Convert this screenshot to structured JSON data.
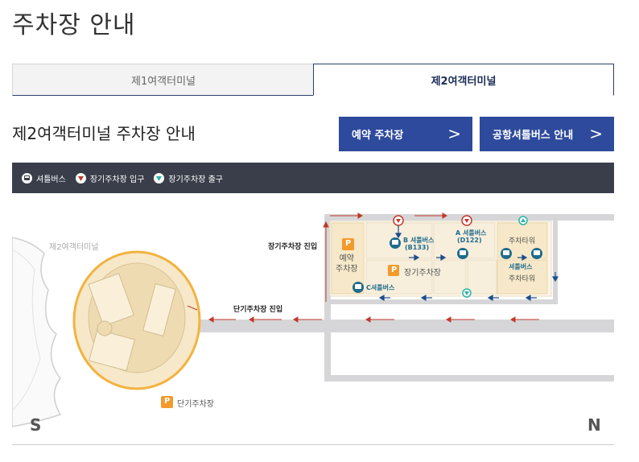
{
  "page": {
    "title": "주차장 안내"
  },
  "tabs": [
    {
      "label": "제1여객터미널",
      "active": false
    },
    {
      "label": "제2여객터미널",
      "active": true
    }
  ],
  "section": {
    "title": "제2여객터미널 주차장 안내"
  },
  "buttons": {
    "reserve_parking": "예약 주차장",
    "shuttle_info": "공항셔틀버스 안내",
    "chevron": ">"
  },
  "legend": [
    {
      "icon": "shuttle-bus-icon",
      "label": "셔틀버스",
      "color": "#1a5a8a"
    },
    {
      "icon": "entrance-icon",
      "label": "장기주차장 입구",
      "color": "#c0392b"
    },
    {
      "icon": "exit-icon",
      "label": "장기주차장 출구",
      "color": "#2bb5a8"
    }
  ],
  "map": {
    "terminal_label": "제2여객터미널",
    "long_term_entry": "장기주차장 진입",
    "short_term_entry": "단기주차장 진입",
    "reserved_parking": "예약\n주차장",
    "long_term_parking": "장기주차장",
    "short_term_parking": "단기주차장",
    "parking_tower_1": "주차타워",
    "parking_tower_2": "주차타워",
    "shuttle_b": "B 셔틀버스",
    "shuttle_b_code": "(B133)",
    "shuttle_a": "A 셔틀버스",
    "shuttle_a_code": "(D122)",
    "shuttle_c": "C셔틀버스",
    "shuttle_tower": "셔틀버스",
    "parking_symbol": "P",
    "south": "S",
    "north": "N",
    "colors": {
      "road": "#d6d6d8",
      "lot": "#f6e8c8",
      "lot_dark": "#eedbb1",
      "accent_orange": "#f39a2b",
      "arrow_red": "#c0392b",
      "arrow_blue": "#1d4d8c",
      "shuttle_teal": "#1f6b8c"
    }
  }
}
